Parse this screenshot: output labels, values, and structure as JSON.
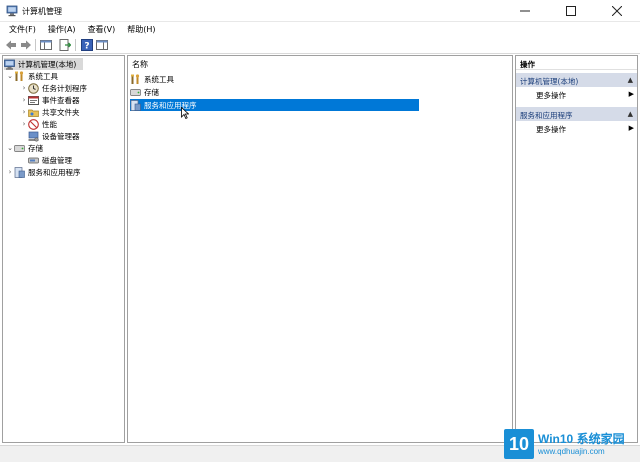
{
  "window": {
    "title": "计算机管理"
  },
  "menu": [
    "文件(F)",
    "操作(A)",
    "查看(V)",
    "帮助(H)"
  ],
  "tree": {
    "root": "计算机管理(本地)",
    "system_tools": "系统工具",
    "task_scheduler": "任务计划程序",
    "event_viewer": "事件查看器",
    "shared_folders": "共享文件夹",
    "performance": "性能",
    "device_manager": "设备管理器",
    "storage": "存储",
    "disk_management": "磁盘管理",
    "services_apps": "服务和应用程序"
  },
  "list": {
    "column_name": "名称",
    "rows": [
      "系统工具",
      "存储",
      "服务和应用程序"
    ]
  },
  "actions": {
    "header": "操作",
    "section1": "计算机管理(本地)",
    "more1": "更多操作",
    "section2": "服务和应用程序",
    "more2": "更多操作"
  },
  "watermark": {
    "logo": "10",
    "title": "Win10 系统家园",
    "url": "www.qdhuajin.com"
  },
  "colors": {
    "selection": "#0078d7",
    "section_bg": "#d5dbe8"
  }
}
